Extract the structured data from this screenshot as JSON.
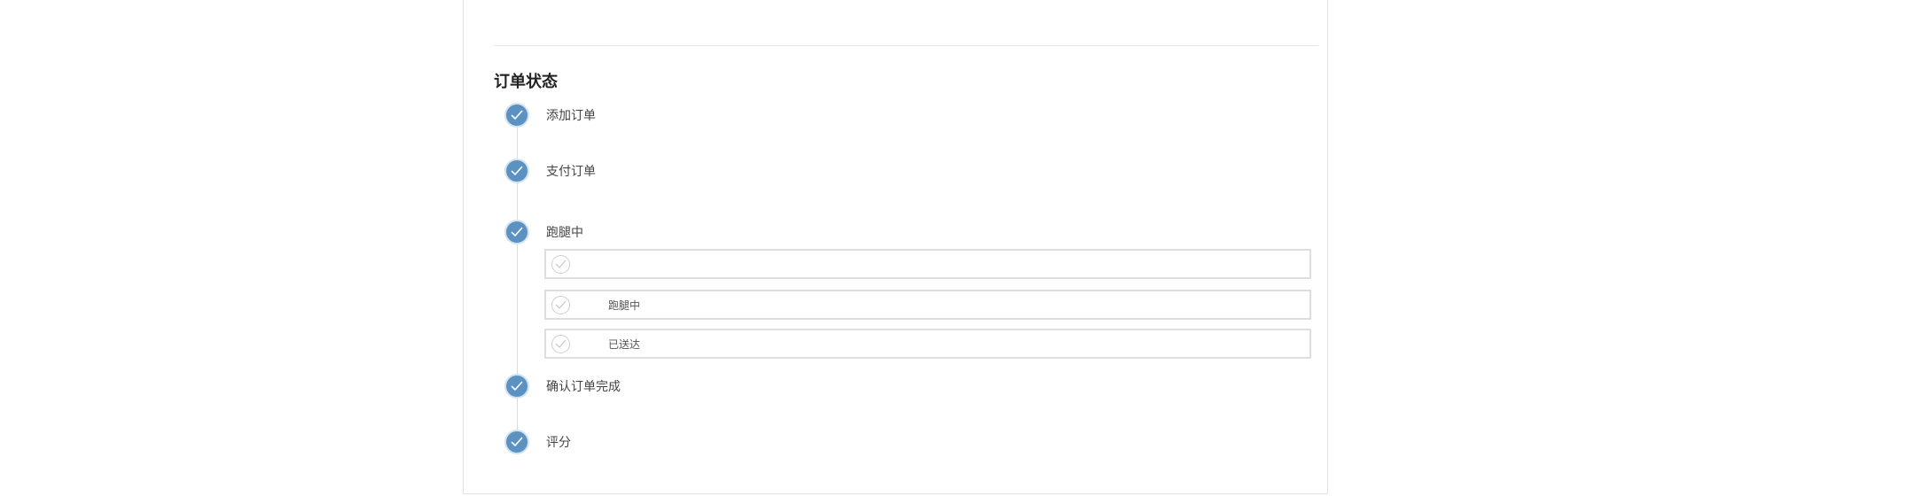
{
  "order_status": {
    "title": "订单状态",
    "steps": [
      {
        "label": "添加订单",
        "done": true
      },
      {
        "label": "支付订单",
        "done": true
      },
      {
        "label": "跑腿中",
        "done": true
      },
      {
        "label": "确认订单完成",
        "done": true
      },
      {
        "label": "评分",
        "done": true
      }
    ],
    "sub_steps": [
      {
        "label": ""
      },
      {
        "label": "跑腿中"
      },
      {
        "label": "已送达"
      }
    ]
  },
  "colors": {
    "step_done": "#5b92c2",
    "line": "#dcdcdc",
    "sub_border": "#dedede"
  }
}
